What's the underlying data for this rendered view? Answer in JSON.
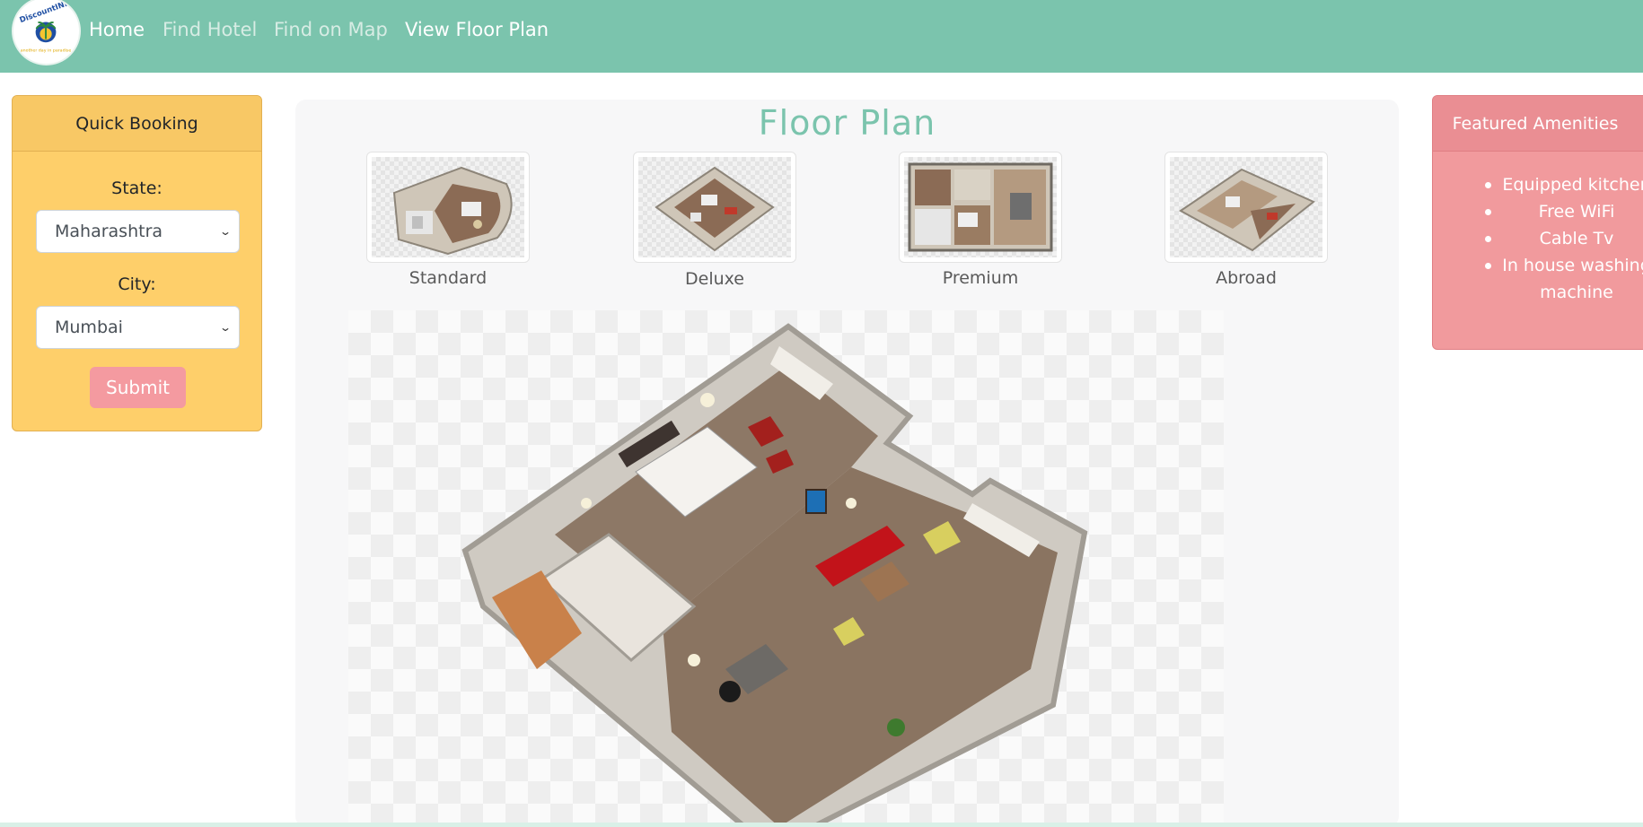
{
  "navbar": {
    "logo_text": "DiscountINN",
    "logo_tagline": "another day in paradise",
    "links": [
      {
        "label": "Home",
        "state": "active"
      },
      {
        "label": "Find Hotel",
        "state": "muted"
      },
      {
        "label": "Find on Map",
        "state": "muted"
      },
      {
        "label": "View Floor Plan",
        "state": "active"
      }
    ],
    "bg_color": "#7bc4ad"
  },
  "quick_booking": {
    "title": "Quick Booking",
    "state_label": "State:",
    "state_value": "Maharashtra",
    "city_label": "City:",
    "city_value": "Mumbai",
    "submit_label": "Submit",
    "bg_color": "#fecf6a"
  },
  "floor_plan": {
    "title": "Floor Plan",
    "options": [
      {
        "label": "Standard"
      },
      {
        "label": "Deluxe"
      },
      {
        "label": "Premium"
      },
      {
        "label": "Abroad"
      }
    ],
    "accent_color": "#7bc4ad"
  },
  "amenities": {
    "title": "Featured Amenities",
    "items": [
      "Equipped kitchen",
      "Free WiFi",
      "Cable Tv",
      "In house washing",
      "machine"
    ],
    "bg_color": "#f19a9d"
  }
}
